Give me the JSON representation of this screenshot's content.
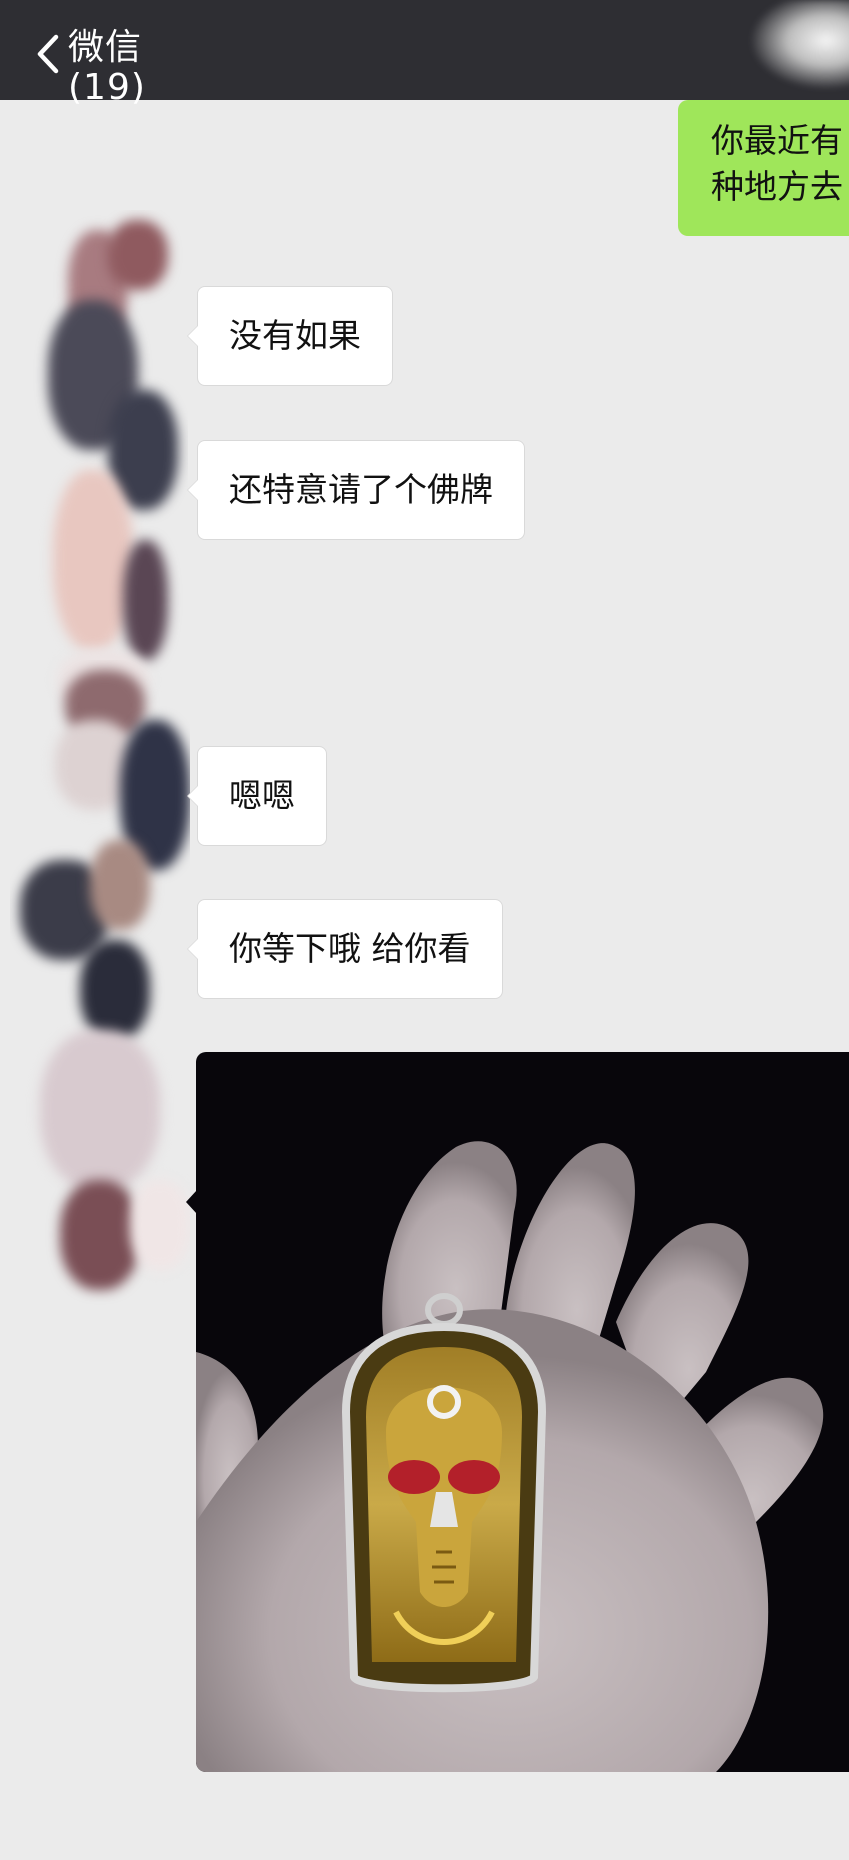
{
  "nav": {
    "back_label": "微信(19)"
  },
  "messages": {
    "outgoing_1": "你最近有\n种地方去",
    "incoming": [
      {
        "text": "没有如果"
      },
      {
        "text": "还特意请了个佛牌"
      },
      {
        "text": "嗯嗯"
      },
      {
        "text": "你等下哦 给你看"
      }
    ],
    "photo": {
      "type": "image",
      "subject": "hand-holding-skull-amulet"
    }
  },
  "colors": {
    "nav_background": "#2e2e33",
    "chat_background": "#ebebeb",
    "outgoing_bubble": "#9fe65a",
    "incoming_bubble": "#ffffff",
    "photo_background": "#08060b"
  },
  "icons": {
    "back": "chevron-left-icon"
  }
}
